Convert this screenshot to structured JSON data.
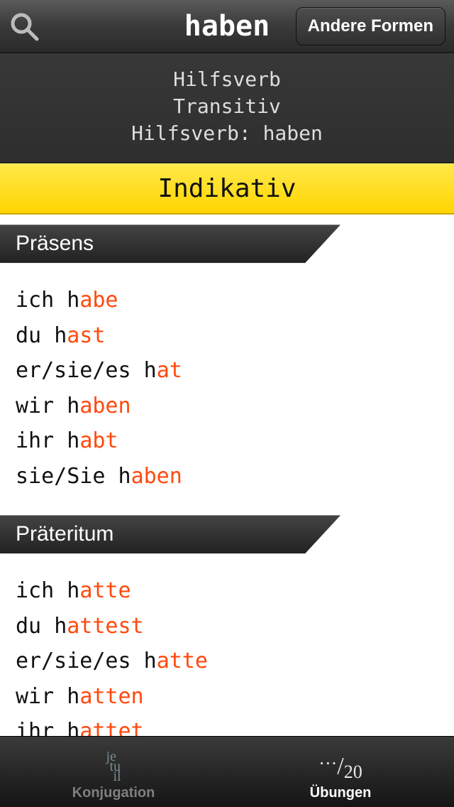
{
  "header": {
    "title": "haben",
    "other_forms_label": "Andere Formen"
  },
  "info": {
    "line1": "Hilfsverb",
    "line2": "Transitiv",
    "line3": "Hilfsverb: haben"
  },
  "mood": "Indikativ",
  "tenses": [
    {
      "name": "Präsens",
      "rows": [
        {
          "pronoun": "ich ",
          "stem": "h",
          "ending": "abe"
        },
        {
          "pronoun": "du ",
          "stem": "h",
          "ending": "ast"
        },
        {
          "pronoun": "er/sie/es ",
          "stem": "h",
          "ending": "at"
        },
        {
          "pronoun": "wir ",
          "stem": "h",
          "ending": "aben"
        },
        {
          "pronoun": "ihr ",
          "stem": "h",
          "ending": "abt"
        },
        {
          "pronoun": "sie/Sie ",
          "stem": "h",
          "ending": "aben"
        }
      ]
    },
    {
      "name": "Präteritum",
      "rows": [
        {
          "pronoun": "ich ",
          "stem": "h",
          "ending": "atte"
        },
        {
          "pronoun": "du ",
          "stem": "h",
          "ending": "attest"
        },
        {
          "pronoun": "er/sie/es ",
          "stem": "h",
          "ending": "atte"
        },
        {
          "pronoun": "wir ",
          "stem": "h",
          "ending": "atten"
        },
        {
          "pronoun": "ihr ",
          "stem": "h",
          "ending": "attet"
        }
      ]
    }
  ],
  "tabs": {
    "conjugation": {
      "label": "Konjugation",
      "icon_text": "je\ntu\nil"
    },
    "exercises": {
      "label": "Übungen",
      "icon_text": "…/20"
    }
  }
}
